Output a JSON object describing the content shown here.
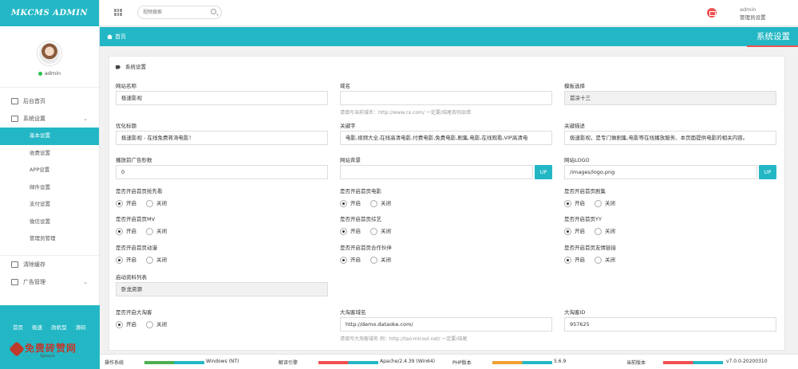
{
  "app": {
    "logo": "MKCMS ADMIN"
  },
  "profile": {
    "name": "admin"
  },
  "sidebar": {
    "items": [
      {
        "label": "后台首页",
        "icon": "monitor-icon"
      },
      {
        "label": "系统设置",
        "icon": "settings-icon",
        "expanded": true
      }
    ],
    "sub_items": [
      {
        "label": "基本设置",
        "active": true
      },
      {
        "label": "收费设置"
      },
      {
        "label": "APP设置"
      },
      {
        "label": "邮件设置"
      },
      {
        "label": "支付设置"
      },
      {
        "label": "微信设置"
      },
      {
        "label": "管理员管理"
      }
    ],
    "bottom_items": [
      {
        "label": "清除缓存",
        "icon": "trash-icon"
      },
      {
        "label": "广告管理",
        "icon": "image-icon"
      }
    ],
    "footer_links": [
      "首页",
      "极速",
      "改机型",
      "源码"
    ],
    "brand_text": "免费砖赞网",
    "brand_sub": "Sgauya"
  },
  "header": {
    "search_placeholder": "视频搜索",
    "user_name": "admin",
    "user_role": "管理员设置"
  },
  "breadcrumb": {
    "home": "首页"
  },
  "page_title": "系统设置",
  "panel": {
    "title": "系统设置",
    "fields": {
      "site_name": {
        "label": "网站名称",
        "value": "极速影视"
      },
      "domain": {
        "label": "域名",
        "value": "",
        "hint": "请填写当前域名：http://www.cx.com/ 一定要/结尾否则出错"
      },
      "template": {
        "label": "模板选择",
        "value": "首涂十三"
      },
      "seo_title": {
        "label": "优化标题",
        "value": "极速影视 - 在线免费蒋涛电影！"
      },
      "keywords": {
        "label": "关键字",
        "value": "电影,视频大全,在线高清电影,付费电影,免费电影,剧集,电影,在线观看,VIP高清电"
      },
      "description": {
        "label": "关键描述",
        "value": "极速影视，是专门做剧集,电影等在线播放服务、本页面提供电影的相关内容。"
      },
      "ad_seconds": {
        "label": "播放前广告秒数",
        "value": "0"
      },
      "background": {
        "label": "网站背景",
        "value": "",
        "button": "UP"
      },
      "site_logo": {
        "label": "网站LOGO",
        "value": "/images/logo.png",
        "button": "UP"
      },
      "invite_list": {
        "label": "启动资料列表",
        "value": "卧龙资源"
      },
      "dataoke_enable": {
        "label": "是否开启大淘客"
      },
      "dataoke_domain": {
        "label": "大淘客域名",
        "value": "http://demo.dataoke.com/",
        "hint": "请填写大淘客域名 例：http://tao.micool.net/ 一定要/结尾"
      },
      "dataoke_id": {
        "label": "大淘客ID",
        "value": "957625"
      }
    },
    "radio_on": "开启",
    "radio_off": "关闭",
    "toggles": [
      {
        "label": "是否开启首页抢先看",
        "value": "on"
      },
      {
        "label": "是否开启首页电影",
        "value": "on"
      },
      {
        "label": "是否开启首页剧集",
        "value": "on"
      },
      {
        "label": "是否开启首页MV",
        "value": "on"
      },
      {
        "label": "是否开启首页综艺",
        "value": "on"
      },
      {
        "label": "是否开启首页YY",
        "value": "on"
      },
      {
        "label": "是否开启首页动漫",
        "value": "on"
      },
      {
        "label": "是否开启首页合作伙伴",
        "value": "on"
      },
      {
        "label": "是否开启首页友情链接",
        "value": "on"
      }
    ],
    "dataoke_toggle": "on"
  },
  "status": {
    "os": {
      "label": "操作系统",
      "value": "Windows (NT)",
      "colors": [
        "#4caf50",
        "#23b7c5"
      ]
    },
    "engine": {
      "label": "解译引擎",
      "value": "Apache/2.4.39 (Win64)",
      "colors": [
        "#f05050",
        "#23b7c5"
      ]
    },
    "php": {
      "label": "PHP版本",
      "value": "5.6.9",
      "colors": [
        "#f0a030",
        "#23b7c5"
      ]
    },
    "version": {
      "label": "当前版本",
      "value": "v7.0.0-20200310",
      "colors": [
        "#f05050",
        "#23b7c5"
      ]
    }
  },
  "colors": {
    "accent": "#23b7c5",
    "danger": "#f05050",
    "online": "#27c24c"
  }
}
